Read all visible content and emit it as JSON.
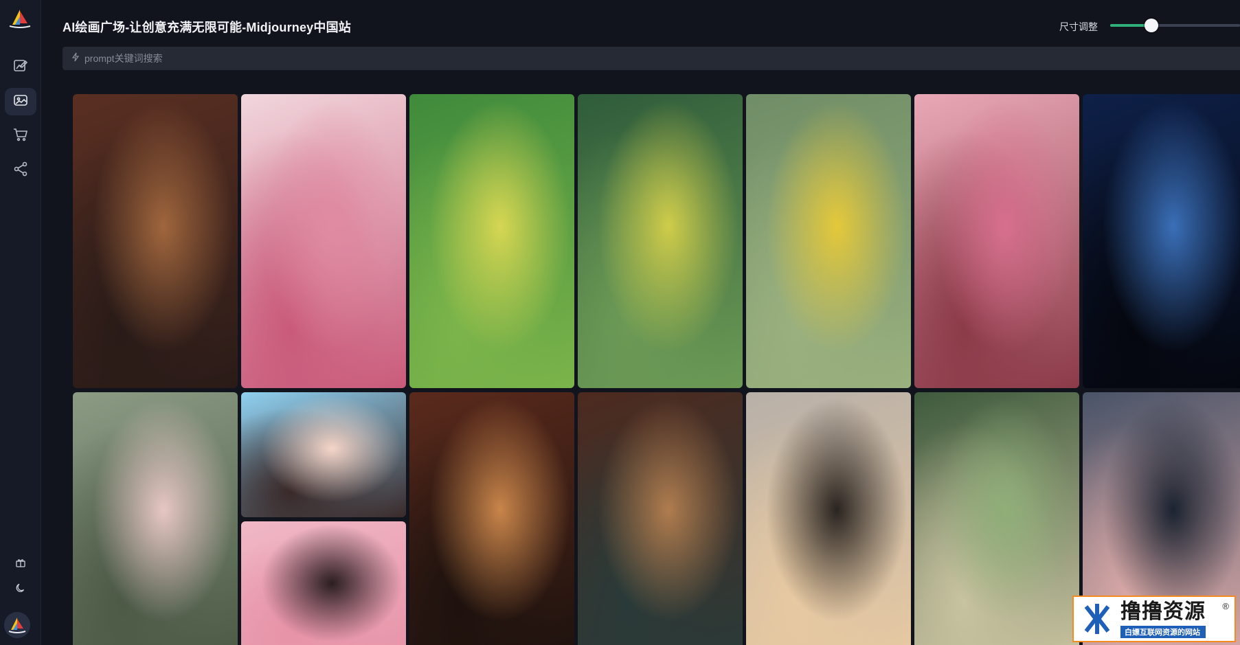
{
  "app": {
    "title": "AI绘画广场-让创意充满无限可能-Midjourney中国站"
  },
  "sidebar": {
    "logo_icon": "sailboat-logo-icon",
    "items": [
      {
        "name": "draw",
        "icon": "edit-image-icon",
        "active": false
      },
      {
        "name": "gallery",
        "icon": "image-gallery-icon",
        "active": true
      },
      {
        "name": "shop",
        "icon": "cart-icon",
        "active": false
      },
      {
        "name": "share",
        "icon": "share-icon",
        "active": false
      }
    ],
    "bottom_items": [
      {
        "name": "gift",
        "icon": "gift-icon"
      },
      {
        "name": "theme",
        "icon": "moon-icon"
      }
    ],
    "avatar_icon": "avatar-icon"
  },
  "header": {
    "size_label": "尺寸调整",
    "size_slider_fraction": 0.32,
    "accent_color": "#2fb07a"
  },
  "search": {
    "placeholder": "prompt关键词搜索",
    "value": "",
    "icon": "lightning-icon"
  },
  "gallery": {
    "images": [
      {
        "alt": "Woman in qipao holding folding fan, ornate window background",
        "palette": [
          "#5a2f22",
          "#a0663d",
          "#2a1b18"
        ]
      },
      {
        "alt": "Pink peach blossoms on branch with calligraphy",
        "palette": [
          "#f1d6dc",
          "#e08ba2",
          "#c95a7a"
        ]
      },
      {
        "alt": "Butterfly on yellow flowers, green background",
        "palette": [
          "#3f8a3c",
          "#d6d652",
          "#7bb44a"
        ]
      },
      {
        "alt": "Yellow buttercup flowers with butterfly",
        "palette": [
          "#2f5c3a",
          "#cfcc4a",
          "#6c9a55"
        ]
      },
      {
        "alt": "Yellow rapeseed flowers with water drops and butterfly",
        "palette": [
          "#6f8d67",
          "#e4c83a",
          "#9ab07e"
        ]
      },
      {
        "alt": "Pink plum blossoms branch",
        "palette": [
          "#e9a8b6",
          "#d76f8e",
          "#8b3a48"
        ]
      },
      {
        "alt": "Full moon night sky with tree silhouette",
        "palette": [
          "#0e2048",
          "#3a6fb8",
          "#05070f"
        ]
      },
      {
        "alt": "Woman in floral hanfu among blossoms",
        "palette": [
          "#8b9b84",
          "#e7c6c4",
          "#4c5a46"
        ]
      },
      {
        "alt": "Cartoon girl with buns on blue background",
        "palette": [
          "#8fd0f0",
          "#f5d5c8",
          "#3a2a2a"
        ]
      },
      {
        "alt": "Woman with pink hair ornament",
        "palette": [
          "#f0b8c6",
          "#2b1e22",
          "#e793a8"
        ]
      },
      {
        "alt": "Woman in corridor with paper lanterns and fan",
        "palette": [
          "#5a2a1c",
          "#c9854a",
          "#1e120e"
        ]
      },
      {
        "alt": "Woman in traditional dress with fan in palace corridor",
        "palette": [
          "#4d2a1f",
          "#b07c4e",
          "#2a3a38"
        ]
      },
      {
        "alt": "Woman in black gown by the sea at sunset",
        "palette": [
          "#b8b0a8",
          "#2a2420",
          "#e7c9a2"
        ]
      },
      {
        "alt": "Woman in green hanfu with headdress",
        "palette": [
          "#3e5a3c",
          "#8fae78",
          "#c8c2a0"
        ]
      },
      {
        "alt": "Illustrated woman with long dark hair",
        "palette": [
          "#4a5468",
          "#1b2330",
          "#d9a8a6"
        ]
      }
    ]
  },
  "watermark": {
    "title": "撸撸资源",
    "subtitle": "白嫖互联网资源的网站",
    "registered": "®",
    "icon": "luluziyuan-logo-icon"
  }
}
